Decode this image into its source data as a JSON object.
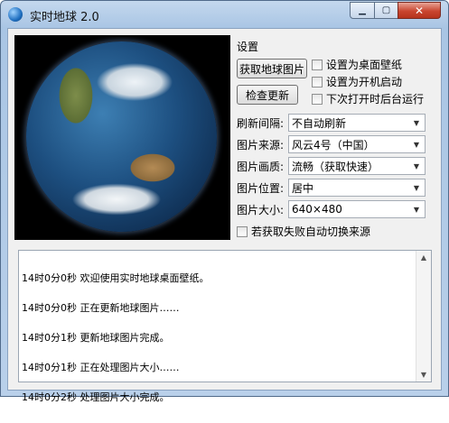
{
  "window": {
    "title": "实时地球 2.0",
    "min_icon": "minimize-icon",
    "max_icon": "maximize-icon",
    "close_icon": "close-icon"
  },
  "settings": {
    "group_title": "设置",
    "get_image_button": "获取地球图片",
    "check_update_button": "检查更新",
    "checkboxes": {
      "set_wallpaper": "设置为桌面壁纸",
      "start_on_boot": "设置为开机启动",
      "run_in_background": "下次打开时后台运行",
      "auto_switch_source": "若获取失败自动切换来源"
    },
    "refresh": {
      "label": "刷新间隔:",
      "value": "不自动刷新"
    },
    "source": {
      "label": "图片来源:",
      "value": "风云4号（中国）"
    },
    "quality": {
      "label": "图片画质:",
      "value": "流畅（获取快速）"
    },
    "position": {
      "label": "图片位置:",
      "value": "居中"
    },
    "size": {
      "label": "图片大小:",
      "value": "640×480"
    }
  },
  "log": {
    "lines": [
      "14时0分0秒 欢迎使用实时地球桌面壁纸。",
      "14时0分0秒 正在更新地球图片……",
      "14时0分1秒 更新地球图片完成。",
      "14时0分1秒 正在处理图片大小……",
      "14时0分2秒 处理图片大小完成。"
    ]
  }
}
